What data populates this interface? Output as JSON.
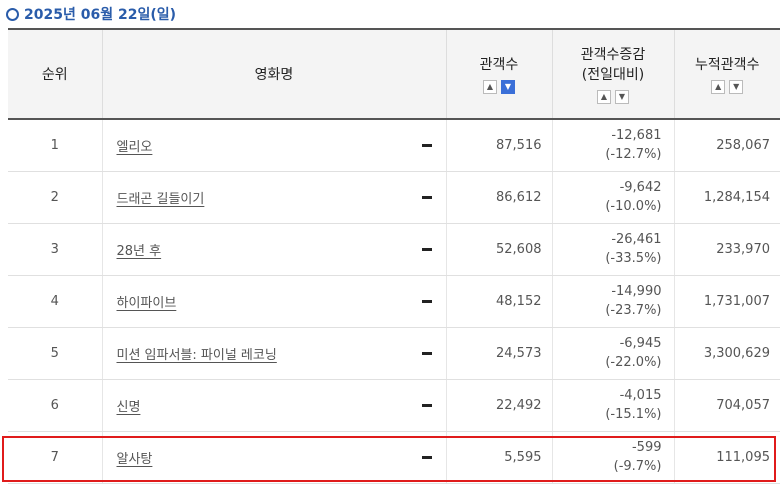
{
  "date_label": "2025년 06월 22일(일)",
  "colors": {
    "accent": "#2a5caa",
    "sort_active": "#3a6fd8",
    "highlight": "#e01b1b"
  },
  "headers": {
    "rank": "순위",
    "title": "영화명",
    "audience": "관객수",
    "change_line1": "관객수증감",
    "change_line2": "(전일대비)",
    "cumulative": "누적관객수"
  },
  "sort_icons": {
    "up": "▲",
    "down": "▼"
  },
  "status_icon": "dash-icon",
  "rows": [
    {
      "rank": "1",
      "title": "엘리오",
      "audience": "87,516",
      "change": "-12,681",
      "change_pct": "(-12.7%)",
      "cumulative": "258,067"
    },
    {
      "rank": "2",
      "title": "드래곤 길들이기",
      "audience": "86,612",
      "change": "-9,642",
      "change_pct": "(-10.0%)",
      "cumulative": "1,284,154"
    },
    {
      "rank": "3",
      "title": "28년 후",
      "audience": "52,608",
      "change": "-26,461",
      "change_pct": "(-33.5%)",
      "cumulative": "233,970"
    },
    {
      "rank": "4",
      "title": "하이파이브",
      "audience": "48,152",
      "change": "-14,990",
      "change_pct": "(-23.7%)",
      "cumulative": "1,731,007"
    },
    {
      "rank": "5",
      "title": "미션 임파서블: 파이널 레코닝",
      "audience": "24,573",
      "change": "-6,945",
      "change_pct": "(-22.0%)",
      "cumulative": "3,300,629"
    },
    {
      "rank": "6",
      "title": "신명",
      "audience": "22,492",
      "change": "-4,015",
      "change_pct": "(-15.1%)",
      "cumulative": "704,057"
    },
    {
      "rank": "7",
      "title": "알사탕",
      "audience": "5,595",
      "change": "-599",
      "change_pct": "(-9.7%)",
      "cumulative": "111,095"
    }
  ]
}
